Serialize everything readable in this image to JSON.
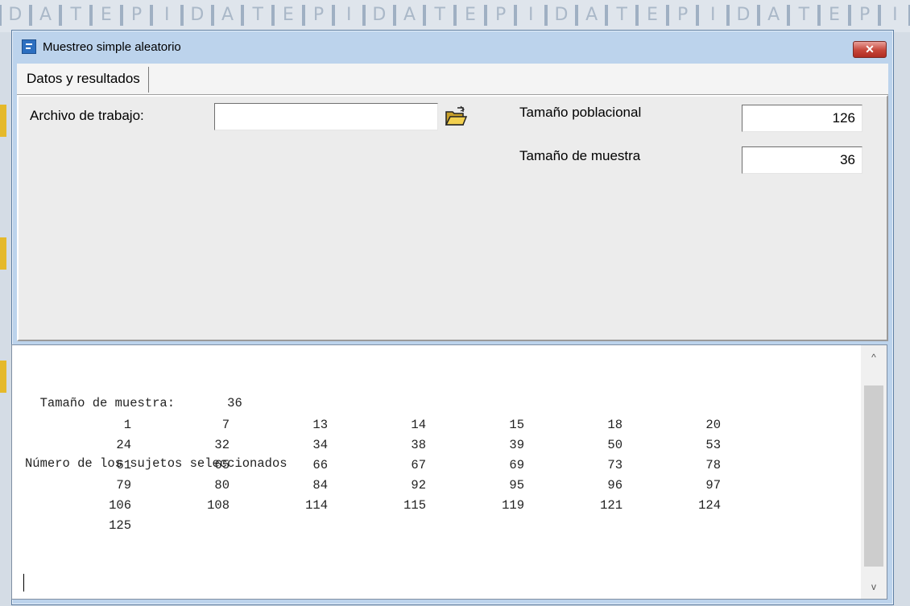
{
  "background": {
    "strip_letters": [
      "D",
      "A",
      "T",
      "E",
      "P",
      "I",
      "D",
      "A",
      "T",
      "E",
      "P",
      "I",
      "D",
      "A",
      "T",
      "E",
      "P",
      "I",
      "D",
      "A",
      "T",
      "E",
      "P",
      "I",
      "D",
      "A",
      "T",
      "E",
      "P",
      "I"
    ]
  },
  "window": {
    "title": "Muestreo simple aleatorio",
    "close_label": "✕",
    "tab_label": "Datos y resultados"
  },
  "form": {
    "file_label": "Archivo de trabajo:",
    "file_value": "",
    "pop_label": "Tamaño poblacional",
    "pop_value": "126",
    "sample_label": "Tamaño de muestra",
    "sample_value": "36"
  },
  "results": {
    "line1": "  Tamaño de muestra:       36",
    "line2": "Número de los sujetos seleccionados",
    "rows": [
      [
        "1",
        "7",
        "13",
        "14",
        "15",
        "18",
        "20"
      ],
      [
        "24",
        "32",
        "34",
        "38",
        "39",
        "50",
        "53"
      ],
      [
        "61",
        "65",
        "66",
        "67",
        "69",
        "73",
        "78"
      ],
      [
        "79",
        "80",
        "84",
        "92",
        "95",
        "96",
        "97"
      ],
      [
        "106",
        "108",
        "114",
        "115",
        "119",
        "121",
        "124"
      ],
      [
        "125"
      ]
    ]
  },
  "scrollbar": {
    "up_glyph": "^",
    "down_glyph": "v"
  },
  "colors": {
    "window_frame": "#bcd3ec",
    "panel": "#ececec",
    "close_button": "#c64639"
  }
}
